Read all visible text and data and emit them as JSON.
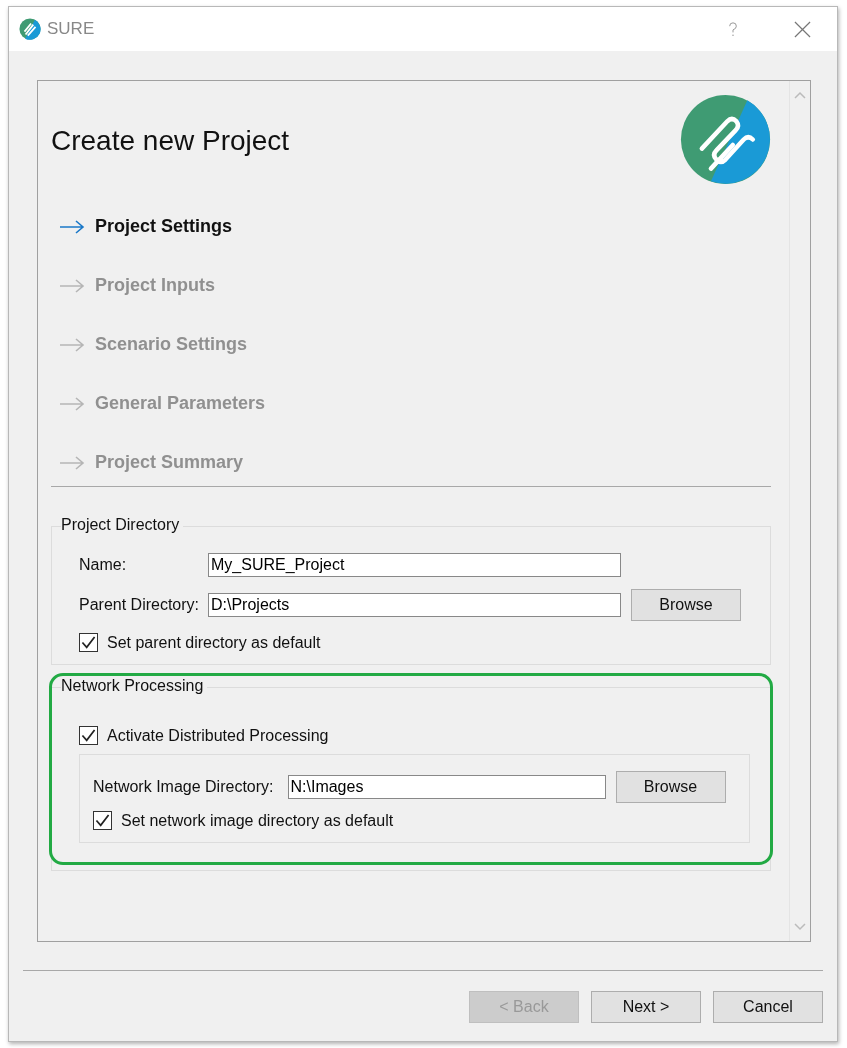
{
  "window": {
    "title": "SURE"
  },
  "header": {
    "title": "Create new Project"
  },
  "steps": [
    {
      "label": "Project Settings",
      "selected": true
    },
    {
      "label": "Project Inputs",
      "selected": false
    },
    {
      "label": "Scenario Settings",
      "selected": false
    },
    {
      "label": "General Parameters",
      "selected": false
    },
    {
      "label": "Project Summary",
      "selected": false
    }
  ],
  "project_directory": {
    "title": "Project Directory",
    "name_label": "Name:",
    "name_value": "My_SURE_Project",
    "parent_label": "Parent Directory:",
    "parent_value": "D:\\Projects",
    "browse": "Browse",
    "default_checkbox": {
      "label": "Set parent directory as default",
      "checked": true
    }
  },
  "network_processing": {
    "title": "Network Processing",
    "activate_checkbox": {
      "label": "Activate Distributed Processing",
      "checked": true
    },
    "dir_label": "Network Image Directory:",
    "dir_value": "N:\\Images",
    "browse": "Browse",
    "default_checkbox": {
      "label": "Set network image directory as default",
      "checked": true
    }
  },
  "buttons": [
    {
      "label": "< Back",
      "disabled": true
    },
    {
      "label": "Next >",
      "disabled": false
    },
    {
      "label": "Cancel",
      "disabled": false
    }
  ]
}
